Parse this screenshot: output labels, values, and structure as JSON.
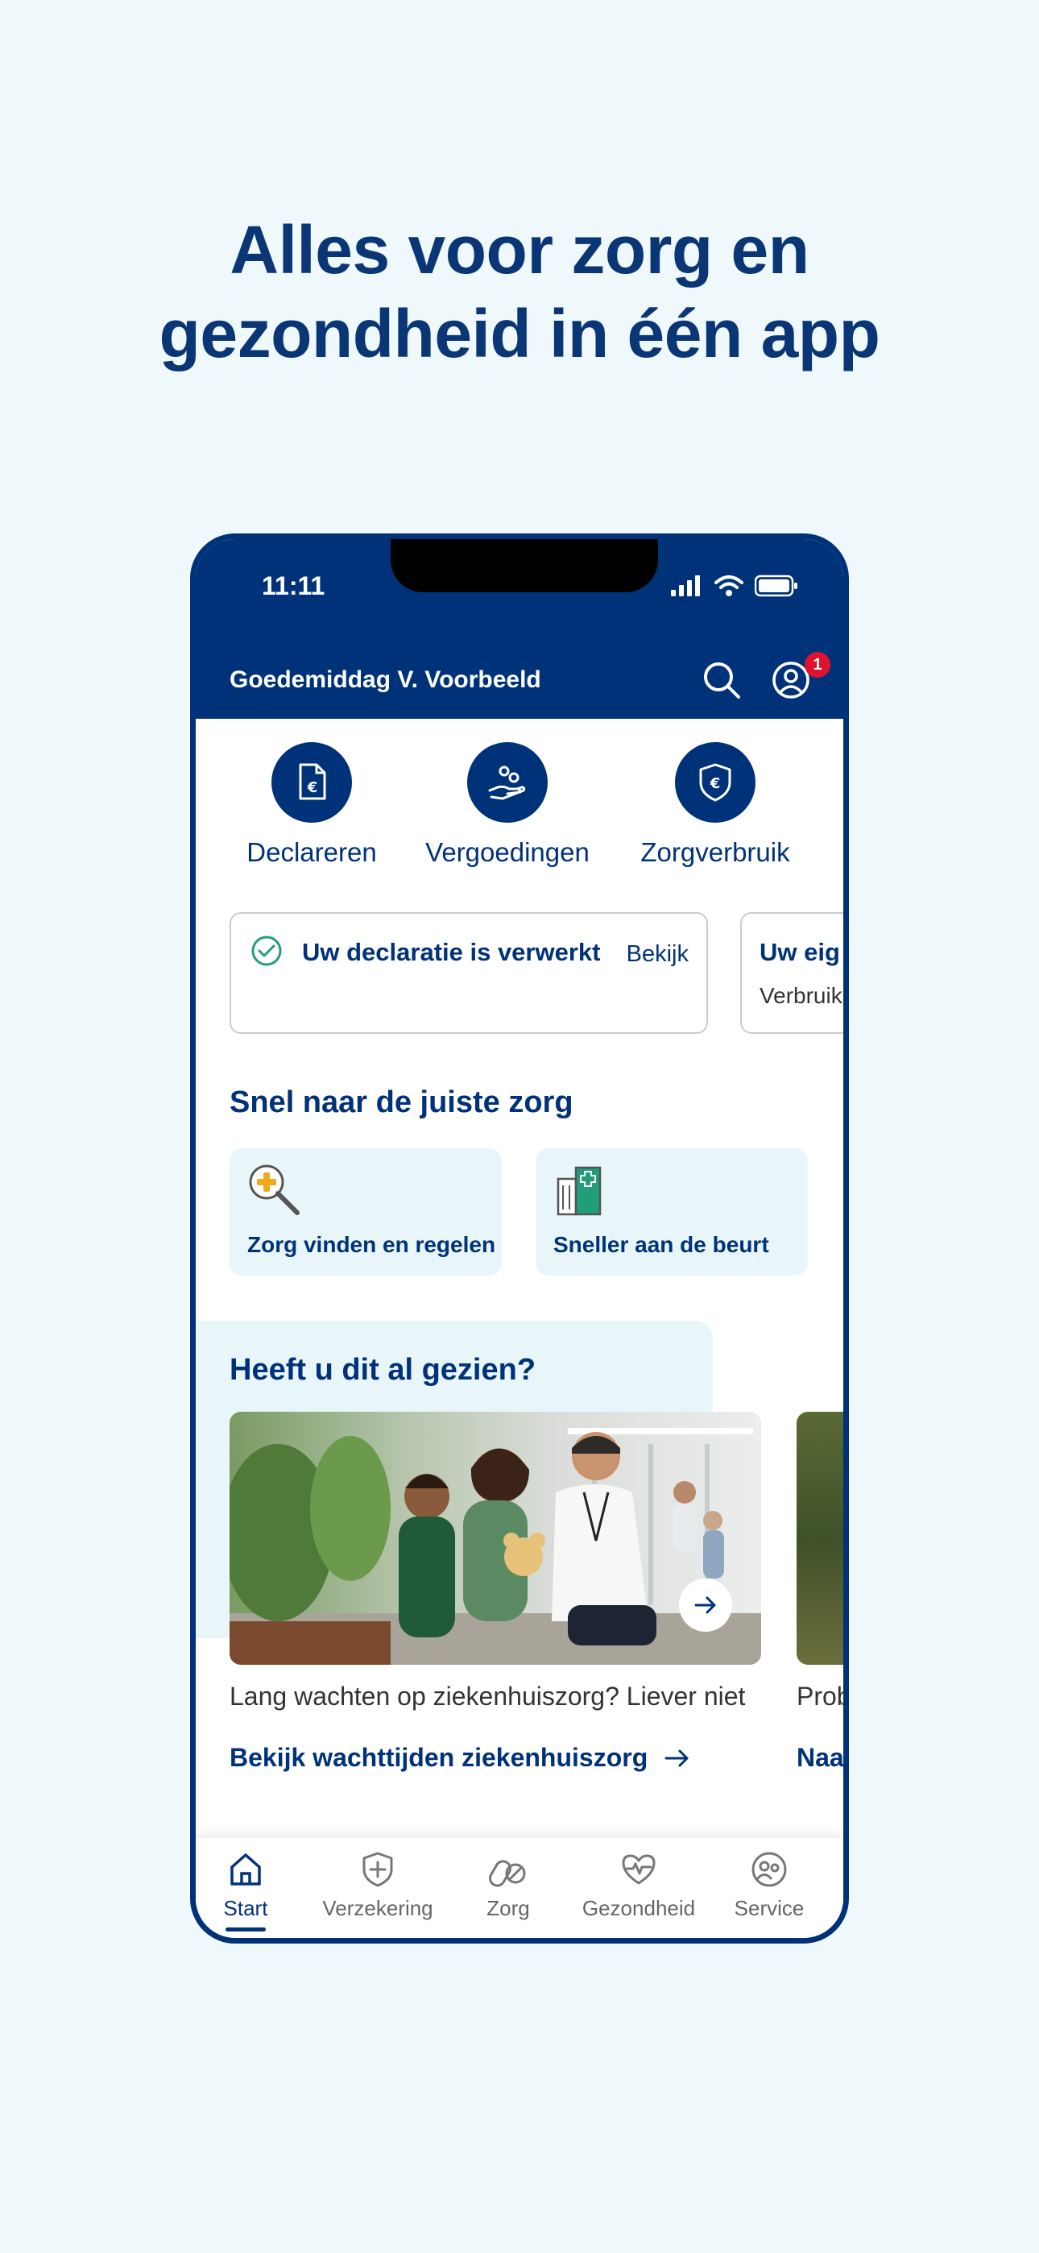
{
  "headline": {
    "line1": "Alles voor zorg en",
    "line2": "gezondheid in één app"
  },
  "status_bar": {
    "time": "11:11"
  },
  "header": {
    "greeting": "Goedemiddag V. Voorbeeld",
    "notification_count": "1"
  },
  "quick_actions": [
    {
      "label": "Declareren",
      "icon": "euro-document-icon"
    },
    {
      "label": "Vergoedingen",
      "icon": "hand-coins-icon"
    },
    {
      "label": "Zorgverbruik",
      "icon": "euro-shield-icon"
    }
  ],
  "cards": [
    {
      "title": "Uw declaratie is verwerkt",
      "link": "Bekijk"
    },
    {
      "title": "Uw eig",
      "subtitle": "Verbruik"
    }
  ],
  "quick_care": {
    "title": "Snel naar de juiste zorg",
    "tiles": [
      {
        "label": "Zorg vinden en regelen",
        "icon": "magnifier-plus-icon"
      },
      {
        "label": "Sneller aan de beurt",
        "icon": "hospital-icon"
      }
    ]
  },
  "seen": {
    "title": "Heeft u dit al gezien?",
    "articles": [
      {
        "text": "Lang wachten op ziekenhuiszorg? Liever niet",
        "link": "Bekijk wachttijden ziekenhuiszorg"
      },
      {
        "text": "Prob",
        "link": "Naa"
      }
    ]
  },
  "bottom_nav": [
    {
      "label": "Start",
      "active": true
    },
    {
      "label": "Verzekering"
    },
    {
      "label": "Zorg"
    },
    {
      "label": "Gezondheid"
    },
    {
      "label": "Service"
    }
  ],
  "colors": {
    "primary": "#00327a",
    "background": "#eff8fa",
    "tile": "#e9f6f9",
    "badge": "#e0132e",
    "success": "#1f9e78"
  }
}
